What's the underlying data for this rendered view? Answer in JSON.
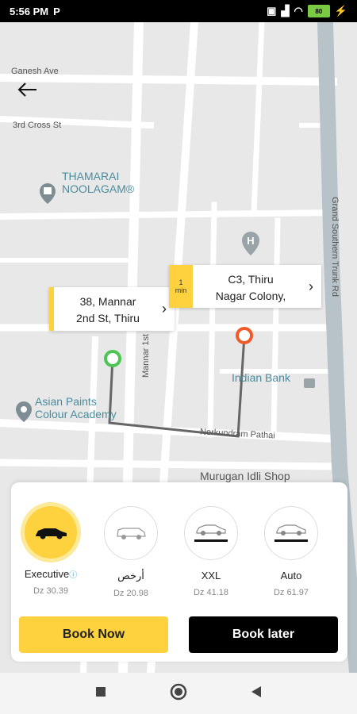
{
  "status": {
    "time": "5:56 PM",
    "carrier_icon": "P",
    "battery": "80"
  },
  "map": {
    "streets": [
      "Ganesh Ave",
      "3rd Cross St",
      "Mannar 1st St",
      "Nerkundram Pathai",
      "Grand Southern Trunk Rd",
      "Murugan Idli Shop"
    ],
    "poi": {
      "thamarai": "THAMARAI\nNOOLAGAM®",
      "asian_paints": "Asian Paints\nColour Academy",
      "indian_bank": "Indian Bank",
      "murugan": "Murugan Idli Shop"
    }
  },
  "pickup": {
    "line1": "38, Mannar",
    "line2": "2nd St, Thiru"
  },
  "dropoff": {
    "line1": "C3, Thiru",
    "line2": "Nagar Colony,",
    "eta_value": "1",
    "eta_unit": "min"
  },
  "cars": [
    {
      "name": "Executive",
      "price": "Dz 30.39",
      "selected": true
    },
    {
      "name": "أرخص",
      "price": "Dz 20.98",
      "selected": false
    },
    {
      "name": "XXL",
      "price": "Dz 41.18",
      "selected": false
    },
    {
      "name": "Auto",
      "price": "Dz 61.97",
      "selected": false
    }
  ],
  "buttons": {
    "book_now": "Book Now",
    "book_later": "Book later"
  },
  "colors": {
    "accent": "#fdd23e",
    "pickup": "#4cc552",
    "dropoff": "#f05a28"
  }
}
